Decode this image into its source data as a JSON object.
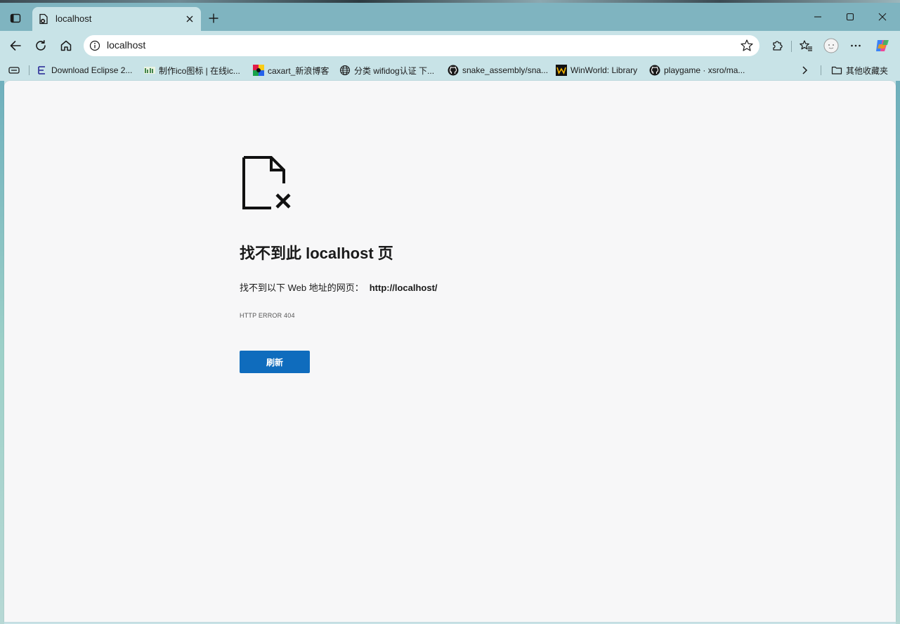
{
  "tab": {
    "title": "localhost"
  },
  "window": {
    "minimize_label": "minimize",
    "maximize_label": "maximize",
    "close_label": "close"
  },
  "omnibox": {
    "url": "localhost"
  },
  "bookmarks": {
    "items": [
      {
        "label": "Download Eclipse 2...",
        "icon": "eclipse-icon"
      },
      {
        "label": "制作ico图标 | 在线ic...",
        "icon": "bitbug-icon"
      },
      {
        "label": "caxart_新浪博客",
        "icon": "caxart-icon"
      },
      {
        "label": "分类 wifidog认证 下...",
        "icon": "globe-icon"
      },
      {
        "label": "snake_assembly/sna...",
        "icon": "github-icon"
      },
      {
        "label": "WinWorld: Library",
        "icon": "winworld-icon"
      },
      {
        "label": "playgame · xsro/ma...",
        "icon": "github-icon"
      }
    ],
    "other": "其他收藏夹"
  },
  "error": {
    "title": "找不到此 localhost 页",
    "desc_prefix": "找不到以下 Web 地址的网页：",
    "desc_url": "http://localhost/",
    "code": "HTTP ERROR 404",
    "reload_label": "刷新"
  },
  "colors": {
    "accent": "#0f6cbd",
    "frame": "#c8e3e7",
    "content_bg": "#f7f7f8"
  }
}
